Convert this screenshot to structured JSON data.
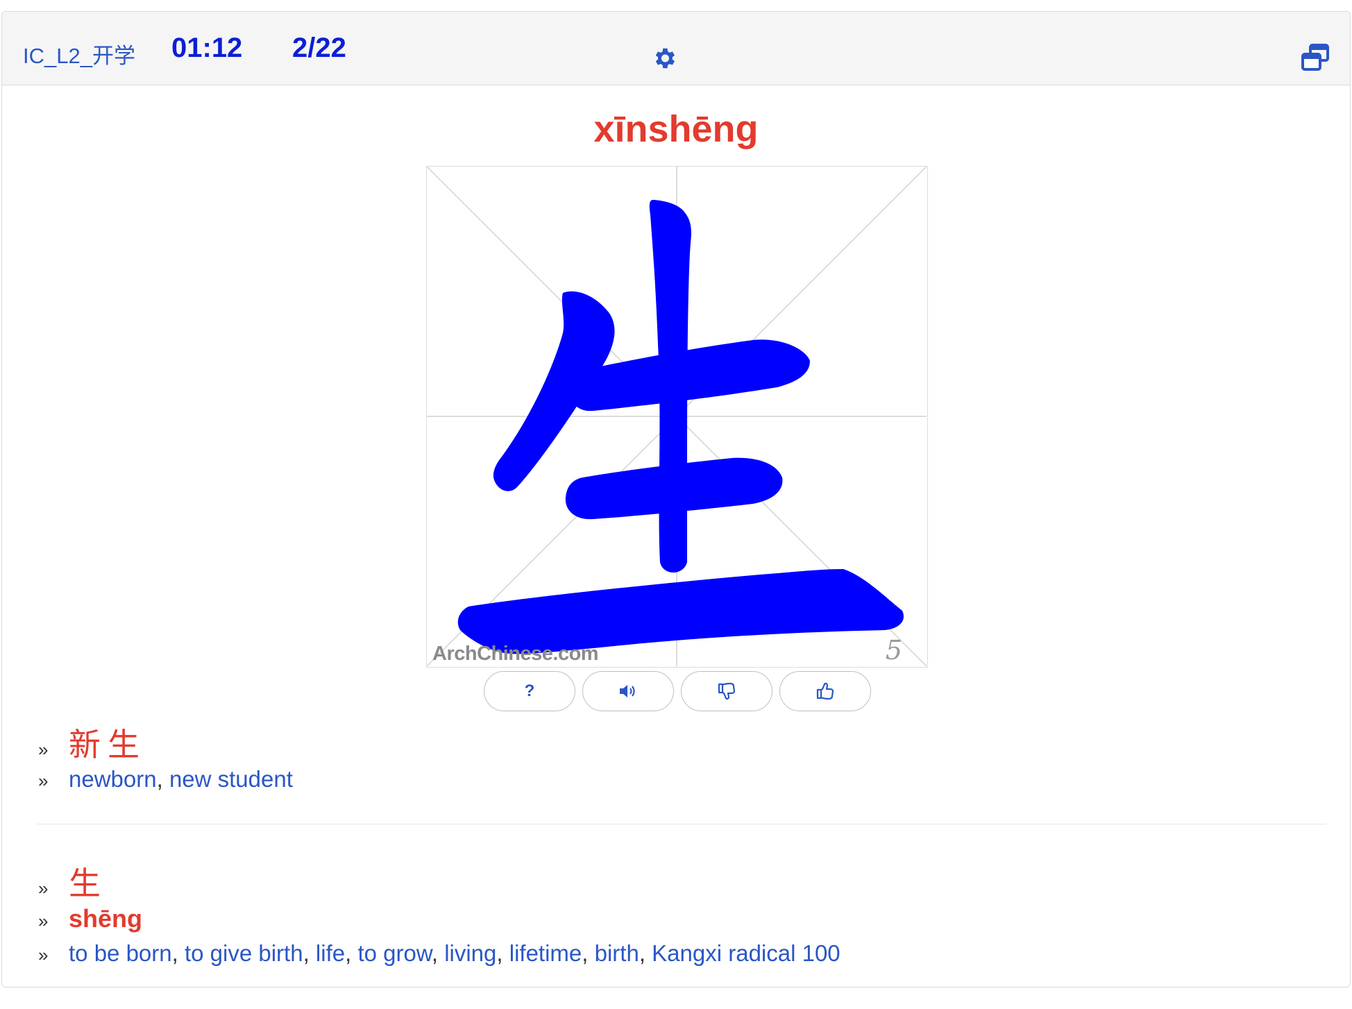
{
  "header": {
    "deck_name": "IC_L2_开学",
    "timer": "01:12",
    "progress": "2/22",
    "settings_icon": "gear-icon",
    "window_icon": "window-restore-icon"
  },
  "card": {
    "pinyin": "xīnshēng",
    "character": "生",
    "watermark": "ArchChinese.com",
    "stroke_count": "5"
  },
  "actions": [
    {
      "name": "help-button",
      "label": "?",
      "icon": "question-icon"
    },
    {
      "name": "audio-button",
      "icon": "speaker-icon"
    },
    {
      "name": "thumbs-down-button",
      "icon": "thumbs-down-icon"
    },
    {
      "name": "thumbs-up-button",
      "icon": "thumbs-up-icon"
    }
  ],
  "word": {
    "hanzi": "新生",
    "meanings": [
      "newborn",
      "new student"
    ]
  },
  "component": {
    "hanzi": "生",
    "pinyin": "shēng",
    "meanings": [
      "to be born",
      "to give birth",
      "life",
      "to grow",
      "living",
      "lifetime",
      "birth",
      "Kangxi radical 100"
    ]
  },
  "bullet": "»",
  "colors": {
    "accent_red": "#e23b2e",
    "link_blue": "#2a56c6",
    "header_blue": "#0b1fd6",
    "stroke_blue": "#0000ff"
  }
}
